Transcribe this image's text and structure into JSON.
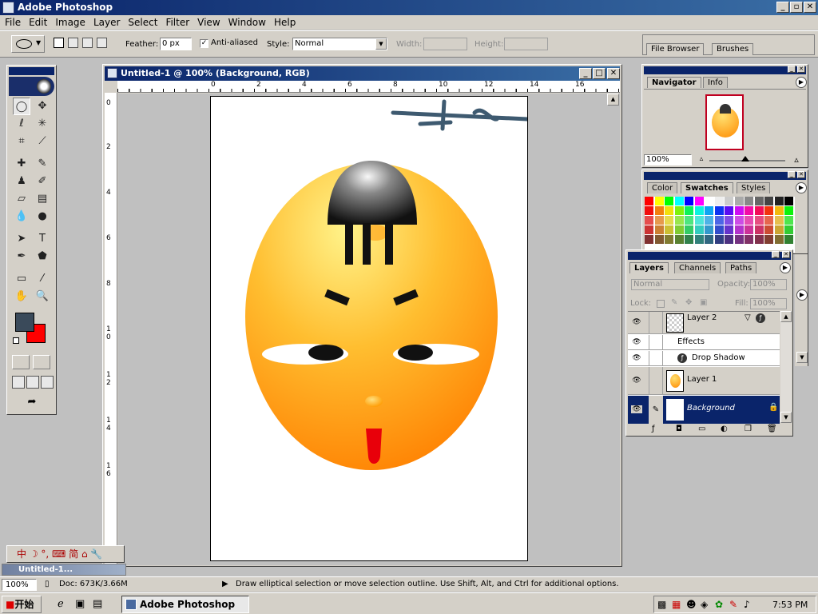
{
  "app": {
    "title": "Adobe Photoshop"
  },
  "menu": [
    "File",
    "Edit",
    "Image",
    "Layer",
    "Select",
    "Filter",
    "View",
    "Window",
    "Help"
  ],
  "options": {
    "feather_label": "Feather:",
    "feather_value": "0 px",
    "antialiased_label": "Anti-aliased",
    "style_label": "Style:",
    "style_value": "Normal",
    "width_label": "Width:",
    "height_label": "Height:",
    "file_browser_tab": "File Browser",
    "brushes_tab": "Brushes"
  },
  "document": {
    "title": "Untitled-1 @ 100% (Background, RGB)",
    "ruler_h": [
      "0",
      "2",
      "4",
      "6",
      "8",
      "10",
      "12",
      "14",
      "16"
    ],
    "ruler_v": [
      "0",
      "2",
      "4",
      "6",
      "8",
      "1",
      "0",
      "1",
      "2",
      "1",
      "4",
      "1",
      "6"
    ]
  },
  "navigator": {
    "tabs": [
      "Navigator",
      "Info"
    ],
    "zoom": "100%"
  },
  "swatches": {
    "tabs": [
      "Color",
      "Swatches",
      "Styles"
    ]
  },
  "layers": {
    "tabs": [
      "Layers",
      "Channels",
      "Paths"
    ],
    "blend_mode": "Normal",
    "opacity_label": "Opacity:",
    "opacity_value": "100%",
    "lock_label": "Lock:",
    "fill_label": "Fill:",
    "fill_value": "100%",
    "items": [
      {
        "name": "Layer 2"
      },
      {
        "name": "Effects"
      },
      {
        "name": "Drop Shadow"
      },
      {
        "name": "Layer 1"
      },
      {
        "name": "Background"
      }
    ]
  },
  "ime": {
    "text": "中 ☽ °, ⌨ 简 ⌂ 🔧"
  },
  "minimized_doc": "Untitled-1...",
  "status": {
    "zoom": "100%",
    "doc": "Doc: 673K/3.66M",
    "message": "Draw elliptical selection or move selection outline.  Use Shift, Alt, and Ctrl for additional options."
  },
  "taskbar": {
    "start": "开始",
    "task": "Adobe Photoshop",
    "time": "7:53 PM"
  },
  "colors": {
    "title_blue": "#0a246a",
    "foreground": "#3a4a5a",
    "background": "#ff0000",
    "egg_light": "#ffe070",
    "egg_dark": "#ff8a00"
  }
}
